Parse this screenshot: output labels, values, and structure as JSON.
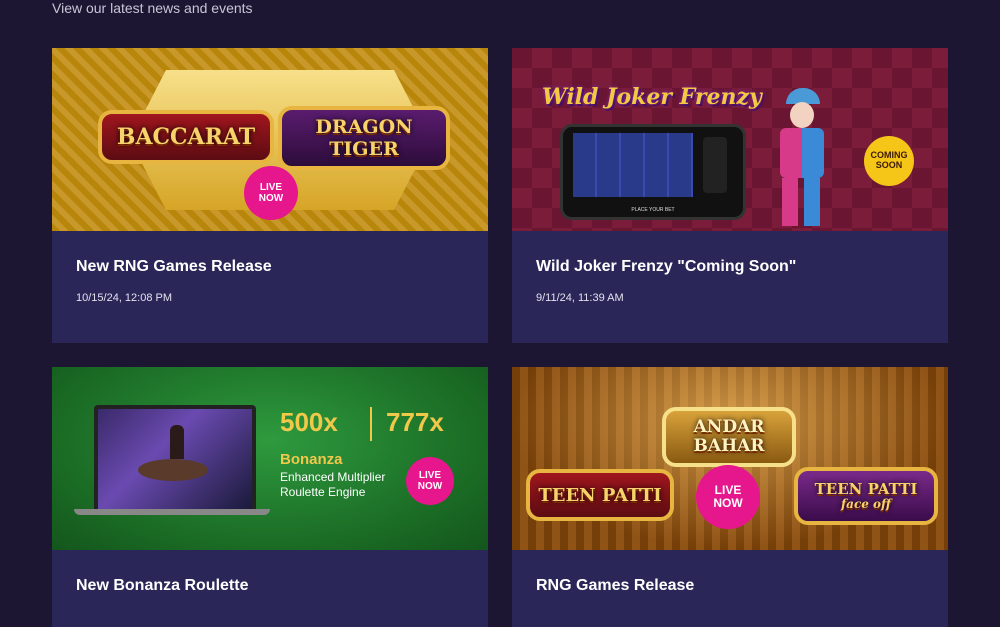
{
  "header": {
    "subtitle": "View our latest news and events"
  },
  "cards": [
    {
      "title": "New RNG Games Release",
      "date": "10/15/24, 12:08 PM",
      "image": {
        "left_title": "BACCARAT",
        "right_title": "DRAGON TIGER",
        "badge": "LIVE NOW"
      }
    },
    {
      "title": "Wild Joker Frenzy \"Coming Soon\"",
      "date": "9/11/24, 11:39 AM",
      "image": {
        "logo": "Wild Joker Frenzy",
        "badge": "COMING SOON",
        "phone_bar": "PLACE YOUR BET"
      }
    },
    {
      "title": "New Bonanza Roulette",
      "image": {
        "mult_left": "500x",
        "mult_right": "777x",
        "name": "Bonanza",
        "tagline": "Enhanced Multiplier Roulette Engine",
        "badge": "LIVE NOW"
      }
    },
    {
      "title": "RNG Games Release",
      "image": {
        "top_title": "ANDAR BAHAR",
        "left_title": "TEEN PATTI",
        "right_title": "TEEN PATTI",
        "right_sub": "face off",
        "badge": "LIVE NOW"
      }
    }
  ],
  "colors": {
    "background": "#1c1632",
    "card": "#2a2758",
    "badge": "#e6168c",
    "bonanza_green": "#1f7a2d"
  }
}
